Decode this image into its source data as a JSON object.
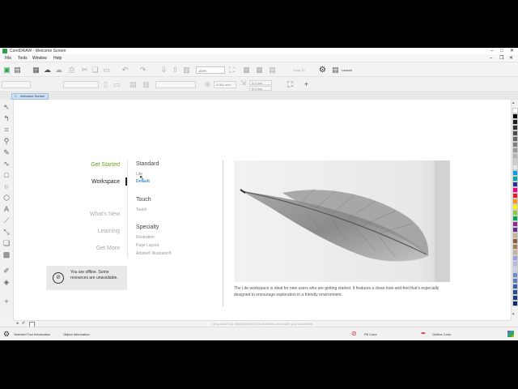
{
  "window": {
    "title": "CorelDRAW - Welcome Screen"
  },
  "menu": {
    "items": [
      "File",
      "Tools",
      "Window",
      "Help"
    ]
  },
  "toolbar": {
    "zoom": "100%",
    "snap_to": "Snap To",
    "launch_label": "Launch"
  },
  "propbar": {
    "nudge": "0.001 mm",
    "dup_x": "5.0 mm",
    "dup_y": "5.0 mm"
  },
  "tab": {
    "label": "Welcome Screen"
  },
  "welcome": {
    "nav": {
      "get_started": "Get Started",
      "workspace": "Workspace",
      "whats_new": "What's New",
      "learning": "Learning",
      "get_more": "Get More"
    },
    "sections": {
      "standard": {
        "title": "Standard",
        "items": [
          "Lite",
          "Default"
        ]
      },
      "touch": {
        "title": "Touch",
        "items": [
          "Touch"
        ]
      },
      "specialty": {
        "title": "Specialty",
        "items": [
          "Illustration",
          "Page Layout",
          "Adobe® Illustrator®"
        ]
      }
    },
    "offline_message": "You are offline. Some resources are unavailable.",
    "description": "The Lite workspace is ideal for new users who are getting started. It features a clean look-and-feel that's especially designed to encourage exploration in a friendly environment."
  },
  "bottom": {
    "drag_hint": "Drag colors (or objects) here to store these colors with your document"
  },
  "status": {
    "selected_tool": "Selected Tool Information",
    "object_info": "Object Information",
    "fill_label": "Fill Color",
    "outline_label": "Outline Color"
  },
  "colors": {
    "accent_green": "#6a9e1f",
    "tab_blue": "#cfe0f4",
    "palette": [
      "#ffffff",
      "#000000",
      "#1a1a1a",
      "#333333",
      "#4d4d4d",
      "#666666",
      "#808080",
      "#999999",
      "#b3b3b3",
      "#cccccc",
      "#e6e6e6",
      "#00a0e3",
      "#00a99d",
      "#2e3192",
      "#ec008c",
      "#ed1c24",
      "#f7941d",
      "#fff200",
      "#8dc63f",
      "#00a651",
      "#92278f",
      "#662d91",
      "#c2b59b",
      "#8b5e3c",
      "#a67c52",
      "#c7b299",
      "#9e9fd6",
      "#b7b6e0",
      "#cfcfee",
      "#6d8fc7",
      "#5b7fbe",
      "#3d5fa8",
      "#2a4b94",
      "#1c3a80",
      "#0c2c6d"
    ]
  },
  "icons": {
    "offline": "cloud-offline-icon",
    "home": "home-icon"
  }
}
